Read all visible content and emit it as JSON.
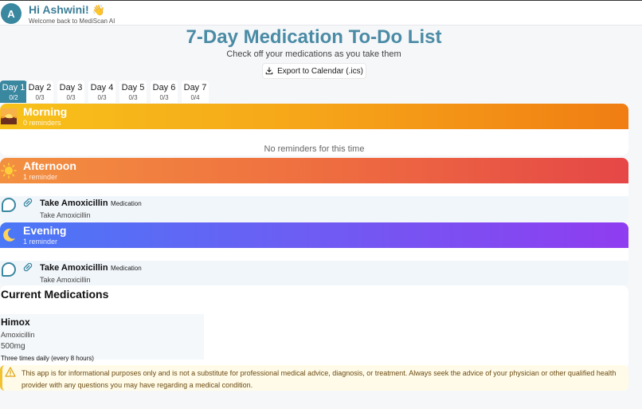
{
  "header": {
    "avatar_letter": "A",
    "greeting": "Hi Ashwini!",
    "wave_emoji": "👋",
    "welcome": "Welcome back to MediScan AI"
  },
  "page": {
    "title": "7-Day Medication To-Do List",
    "subtitle": "Check off your medications as you take them",
    "export_label": "Export to Calendar (.ics)"
  },
  "days": [
    {
      "label": "Day 1",
      "count": "0/2",
      "active": true
    },
    {
      "label": "Day 2",
      "count": "0/3",
      "active": false
    },
    {
      "label": "Day 3",
      "count": "0/3",
      "active": false
    },
    {
      "label": "Day 4",
      "count": "0/3",
      "active": false
    },
    {
      "label": "Day 5",
      "count": "0/3",
      "active": false
    },
    {
      "label": "Day 6",
      "count": "0/3",
      "active": false
    },
    {
      "label": "Day 7",
      "count": "0/4",
      "active": false
    }
  ],
  "sections": {
    "morning": {
      "title": "Morning",
      "count": "0 reminders",
      "empty_text": "No reminders for this time",
      "icon": "sunrise-icon"
    },
    "afternoon": {
      "title": "Afternoon",
      "count": "1 reminder",
      "icon": "sun-icon",
      "reminders": [
        {
          "title": "Take Amoxicillin",
          "tag": "Medication",
          "subtitle": "Take Amoxicillin"
        }
      ]
    },
    "evening": {
      "title": "Evening",
      "count": "1 reminder",
      "icon": "moon-icon",
      "reminders": [
        {
          "title": "Take Amoxicillin",
          "tag": "Medication",
          "subtitle": "Take Amoxicillin"
        }
      ]
    }
  },
  "current": {
    "title": "Current Medications",
    "meds": [
      {
        "name": "Himox",
        "generic": "Amoxicillin",
        "dose": "500mg",
        "frequency": "Three times daily (every 8 hours)"
      }
    ]
  },
  "disclaimer": "This app is for informational purposes only and is not a substitute for professional medical advice, diagnosis, or treatment. Always seek the advice of your physician or other qualified health provider with any questions you may have regarding a medical condition.",
  "colors": {
    "accent": "#3a87a0",
    "title": "#4a8ba5",
    "warning": "#f2c230"
  }
}
